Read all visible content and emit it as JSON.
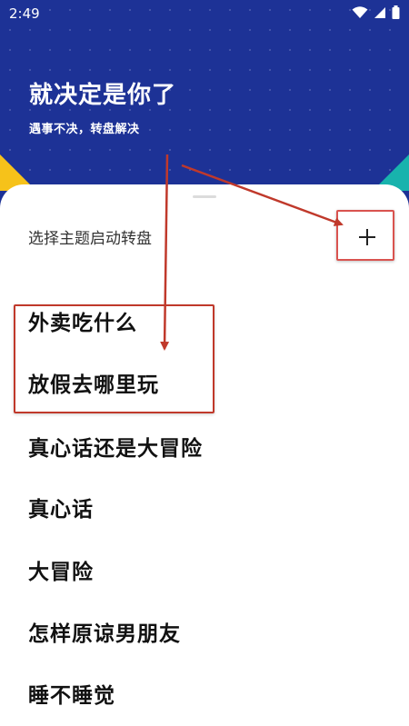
{
  "status_bar": {
    "time": "2:49"
  },
  "header": {
    "title": "就决定是你了",
    "subtitle": "遇事不决，转盘解决"
  },
  "sheet": {
    "label": "选择主题启动转盘",
    "add_button_icon": "plus-icon"
  },
  "topics": [
    "外卖吃什么",
    "放假去哪里玩",
    "真心话还是大冒险",
    "真心话",
    "大冒险",
    "怎样原谅男朋友",
    "睡不睡觉"
  ],
  "colors": {
    "header_bg": "#1d3296",
    "accent_yellow": "#f6c21a",
    "accent_teal": "#18b3ad",
    "annotation_red": "#c0392b"
  }
}
